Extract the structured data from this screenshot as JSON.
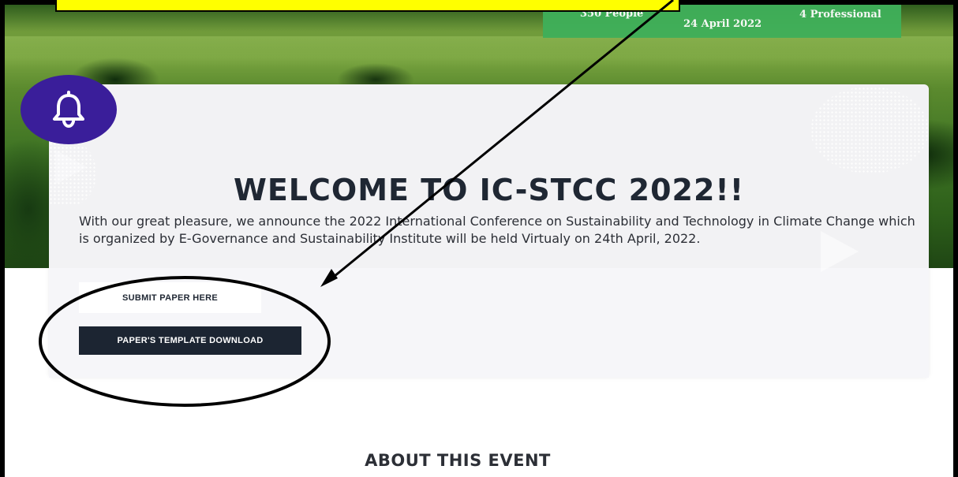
{
  "stats": {
    "people": "350 People",
    "date": "24 April 2022",
    "professional": "4 Professional"
  },
  "notification": {
    "icon": "bell-icon"
  },
  "welcome": {
    "title": "WELCOME TO IC-STCC 2022!!",
    "intro": "With our great pleasure, we announce the 2022 International Conference on Sustainability and Technology in Climate Change which is organized by E-Governance and Sustainability Institute will be held Virtualy on 24th April, 2022."
  },
  "buttons": {
    "submit_paper": "SUBMIT PAPER HERE",
    "template_download": "PAPER'S TEMPLATE DOWNLOAD"
  },
  "sections": {
    "about": "ABOUT THIS EVENT"
  },
  "colors": {
    "badge": "#3a1e9a",
    "stats_bar": "#3fb05a",
    "dark_button": "#1c2532",
    "highlight": "#ffff00"
  }
}
